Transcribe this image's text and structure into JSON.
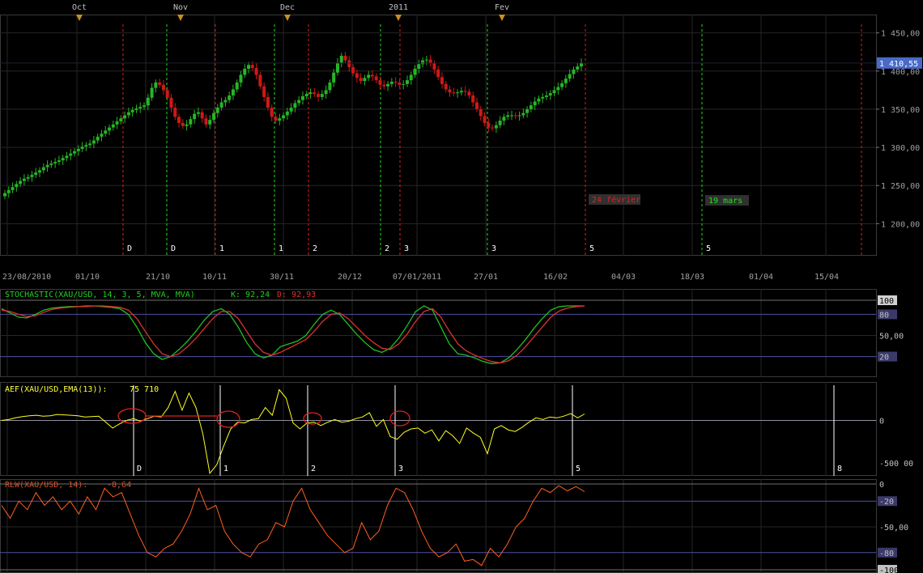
{
  "chart_data": [
    {
      "type": "candlestick",
      "title": "",
      "top_labels": [
        "Oct",
        "Nov",
        "Dec",
        "2011",
        "Fev"
      ],
      "x_ticks": [
        "23/08/2010",
        "01/10",
        "21/10",
        "10/11",
        "30/11",
        "20/12",
        "07/01/2011",
        "27/01",
        "16/02",
        "04/03",
        "18/03",
        "01/04",
        "15/04"
      ],
      "y_ticks": [
        "1 450,00",
        "1 400,00",
        "1 350,00",
        "1 300,00",
        "1 250,00",
        "1 200,00"
      ],
      "ylim": [
        1158,
        1474
      ],
      "last_price": "1 410,55",
      "close": [
        1240,
        1244,
        1248,
        1252,
        1256,
        1259,
        1261,
        1264,
        1267,
        1270,
        1274,
        1277,
        1279,
        1281,
        1283,
        1286,
        1289,
        1292,
        1295,
        1298,
        1301,
        1303,
        1305,
        1309,
        1314,
        1318,
        1322,
        1326,
        1330,
        1334,
        1338,
        1342,
        1346,
        1349,
        1351,
        1353,
        1355,
        1365,
        1378,
        1385,
        1382,
        1375,
        1365,
        1352,
        1340,
        1332,
        1328,
        1330,
        1337,
        1344,
        1346,
        1338,
        1330,
        1336,
        1345,
        1352,
        1359,
        1362,
        1368,
        1376,
        1385,
        1395,
        1403,
        1408,
        1404,
        1395,
        1380,
        1366,
        1352,
        1340,
        1335,
        1338,
        1342,
        1347,
        1352,
        1358,
        1362,
        1367,
        1370,
        1372,
        1370,
        1366,
        1370,
        1375,
        1385,
        1398,
        1411,
        1420,
        1414,
        1405,
        1397,
        1391,
        1387,
        1391,
        1395,
        1393,
        1388,
        1382,
        1380,
        1383,
        1386,
        1385,
        1382,
        1383,
        1388,
        1395,
        1403,
        1409,
        1414,
        1415,
        1410,
        1402,
        1392,
        1383,
        1376,
        1372,
        1371,
        1372,
        1374,
        1373,
        1368,
        1359,
        1350,
        1341,
        1332,
        1326,
        1325,
        1329,
        1335,
        1340,
        1342,
        1342,
        1341,
        1342,
        1345,
        1350,
        1355,
        1360,
        1364,
        1366,
        1368,
        1371,
        1375,
        1379,
        1384,
        1390,
        1396,
        1402,
        1406,
        1410.55
      ],
      "markers": [
        {
          "label": "D",
          "color": "#e02020"
        },
        {
          "label": "D",
          "color": "#20e020"
        },
        {
          "label": "1",
          "color": "#e02020"
        },
        {
          "label": "1",
          "color": "#20e020"
        },
        {
          "label": "2",
          "color": "#e02020"
        },
        {
          "label": "2",
          "color": "#20e020"
        },
        {
          "label": "3",
          "color": "#e02020"
        },
        {
          "label": "3",
          "color": "#20e020"
        },
        {
          "label": "5",
          "color": "#e02020"
        },
        {
          "label": "5",
          "color": "#20e020"
        },
        {
          "label": "",
          "color": "#e02020"
        }
      ],
      "annotations": [
        {
          "text": "24 février",
          "color": "#e02020"
        },
        {
          "text": "19 mars",
          "color": "#20e020"
        }
      ]
    },
    {
      "type": "line",
      "title": "STOCHASTIC(XAU/USD, 14, 3, 5, MVA, MVA)",
      "k_label": "K: 92,24",
      "d_label": "D: 92,93",
      "y_ticks": [
        "100",
        "80",
        "50,00",
        "20"
      ],
      "ylim": [
        0,
        100
      ],
      "series": [
        {
          "name": "K",
          "color": "#20c020",
          "values": [
            88,
            82,
            76,
            75,
            80,
            86,
            89,
            90,
            91,
            91,
            92,
            92,
            91,
            90,
            88,
            80,
            62,
            40,
            24,
            16,
            20,
            30,
            42,
            56,
            72,
            84,
            88,
            80,
            62,
            40,
            24,
            18,
            22,
            34,
            38,
            42,
            50,
            66,
            80,
            86,
            80,
            66,
            52,
            40,
            30,
            26,
            32,
            46,
            64,
            84,
            92,
            86,
            62,
            38,
            24,
            22,
            18,
            13,
            10,
            11,
            18,
            30,
            44,
            60,
            74,
            86,
            91,
            92,
            92,
            92
          ]
        },
        {
          "name": "D",
          "color": "#e03030",
          "values": [
            86,
            84,
            80,
            77,
            78,
            83,
            87,
            89,
            90,
            91,
            91,
            92,
            92,
            91,
            90,
            86,
            74,
            56,
            38,
            24,
            20,
            24,
            34,
            46,
            60,
            74,
            84,
            84,
            74,
            56,
            38,
            26,
            22,
            26,
            32,
            38,
            44,
            56,
            70,
            80,
            82,
            74,
            62,
            50,
            40,
            32,
            30,
            38,
            52,
            70,
            84,
            88,
            76,
            56,
            38,
            28,
            22,
            17,
            13,
            11,
            14,
            22,
            34,
            48,
            62,
            76,
            85,
            89,
            91,
            92
          ]
        }
      ]
    },
    {
      "type": "line",
      "title": "AEF(XAU/USD,EMA(13)):",
      "value_label": "75 710",
      "y_ticks": [
        "0",
        "-500 00"
      ],
      "ylim": [
        -650000,
        450000
      ],
      "series": [
        {
          "name": "AEF",
          "color": "#ffff20",
          "values": [
            0,
            10000,
            30000,
            45000,
            55000,
            60000,
            50000,
            55000,
            70000,
            65000,
            60000,
            55000,
            40000,
            45000,
            50000,
            -20000,
            -90000,
            -40000,
            0,
            20000,
            -10000,
            20000,
            50000,
            40000,
            150000,
            340000,
            120000,
            320000,
            150000,
            -160000,
            -620000,
            -520000,
            -300000,
            -100000,
            -20000,
            -30000,
            10000,
            20000,
            150000,
            60000,
            360000,
            260000,
            -30000,
            -100000,
            -30000,
            -20000,
            -60000,
            -20000,
            10000,
            -20000,
            -10000,
            20000,
            40000,
            90000,
            -70000,
            10000,
            -190000,
            -220000,
            -140000,
            -100000,
            -90000,
            -150000,
            -110000,
            -240000,
            -120000,
            -180000,
            -270000,
            -90000,
            -150000,
            -200000,
            -390000,
            -100000,
            -60000,
            -110000,
            -130000,
            -80000,
            -20000,
            30000,
            10000,
            40000,
            30000,
            50000,
            80000,
            30000,
            75710
          ]
        }
      ],
      "markers": [
        "D",
        "1",
        "2",
        "3",
        "5",
        "8"
      ]
    },
    {
      "type": "line",
      "title": "RLW(XAU/USD, 14):",
      "value_label": "-8,64",
      "y_ticks": [
        "0",
        "-20",
        "-50,00",
        "-80",
        "-100"
      ],
      "ylim": [
        -100,
        0
      ],
      "series": [
        {
          "name": "RLW",
          "color": "#ff6020",
          "values": [
            -25,
            -40,
            -20,
            -30,
            -10,
            -25,
            -15,
            -30,
            -20,
            -35,
            -15,
            -30,
            -5,
            -15,
            -10,
            -35,
            -60,
            -80,
            -85,
            -75,
            -70,
            -55,
            -35,
            -5,
            -30,
            -25,
            -55,
            -70,
            -80,
            -85,
            -70,
            -65,
            -45,
            -50,
            -20,
            -5,
            -30,
            -45,
            -60,
            -70,
            -80,
            -75,
            -45,
            -65,
            -55,
            -25,
            -5,
            -10,
            -30,
            -55,
            -75,
            -85,
            -80,
            -70,
            -90,
            -88,
            -95,
            -75,
            -85,
            -70,
            -50,
            -40,
            -20,
            -5,
            -10,
            -2,
            -8,
            -3,
            -9
          ]
        }
      ]
    }
  ]
}
